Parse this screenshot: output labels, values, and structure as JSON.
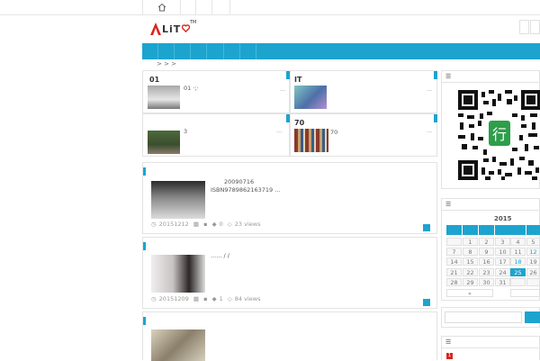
{
  "header": {
    "home_icon": "home-icon",
    "logo_text": "LiT",
    "logo_tm": "TM"
  },
  "breadcrumb": {
    "separators": "> > >"
  },
  "featured": [
    {
      "title": "01",
      "caption": "01 ·;·",
      "more": "..."
    },
    {
      "title": "IT",
      "caption": "",
      "more": "..."
    },
    {
      "title": "",
      "caption": "3",
      "more": "..."
    },
    {
      "title": "70",
      "caption": "70",
      "more": "..."
    }
  ],
  "posts": [
    {
      "line1": "20090716",
      "line2": "ISBN9789862163719   ...",
      "date": "20151212",
      "comments": "0",
      "views": "23 views"
    },
    {
      "line1": "...... / /",
      "line2": "",
      "date": "20151209",
      "comments": "1",
      "views": "84 views"
    }
  ],
  "qr": {
    "center_char": "行"
  },
  "calendar": {
    "title": "2015",
    "rows": [
      [
        "",
        "1",
        "2",
        "3",
        "4",
        "5"
      ],
      [
        "7",
        "8",
        "9",
        "10",
        "11",
        "12"
      ],
      [
        "14",
        "15",
        "16",
        "17",
        "18",
        "19"
      ],
      [
        "21",
        "22",
        "23",
        "24",
        "25",
        "26"
      ],
      [
        "28",
        "29",
        "30",
        "31",
        "",
        ""
      ]
    ],
    "prev": "«",
    "today": "25"
  },
  "search": {
    "placeholder": ""
  },
  "tag_count": "1",
  "colors": {
    "accent": "#1ca4cf",
    "logo_red": "#d9261c"
  }
}
